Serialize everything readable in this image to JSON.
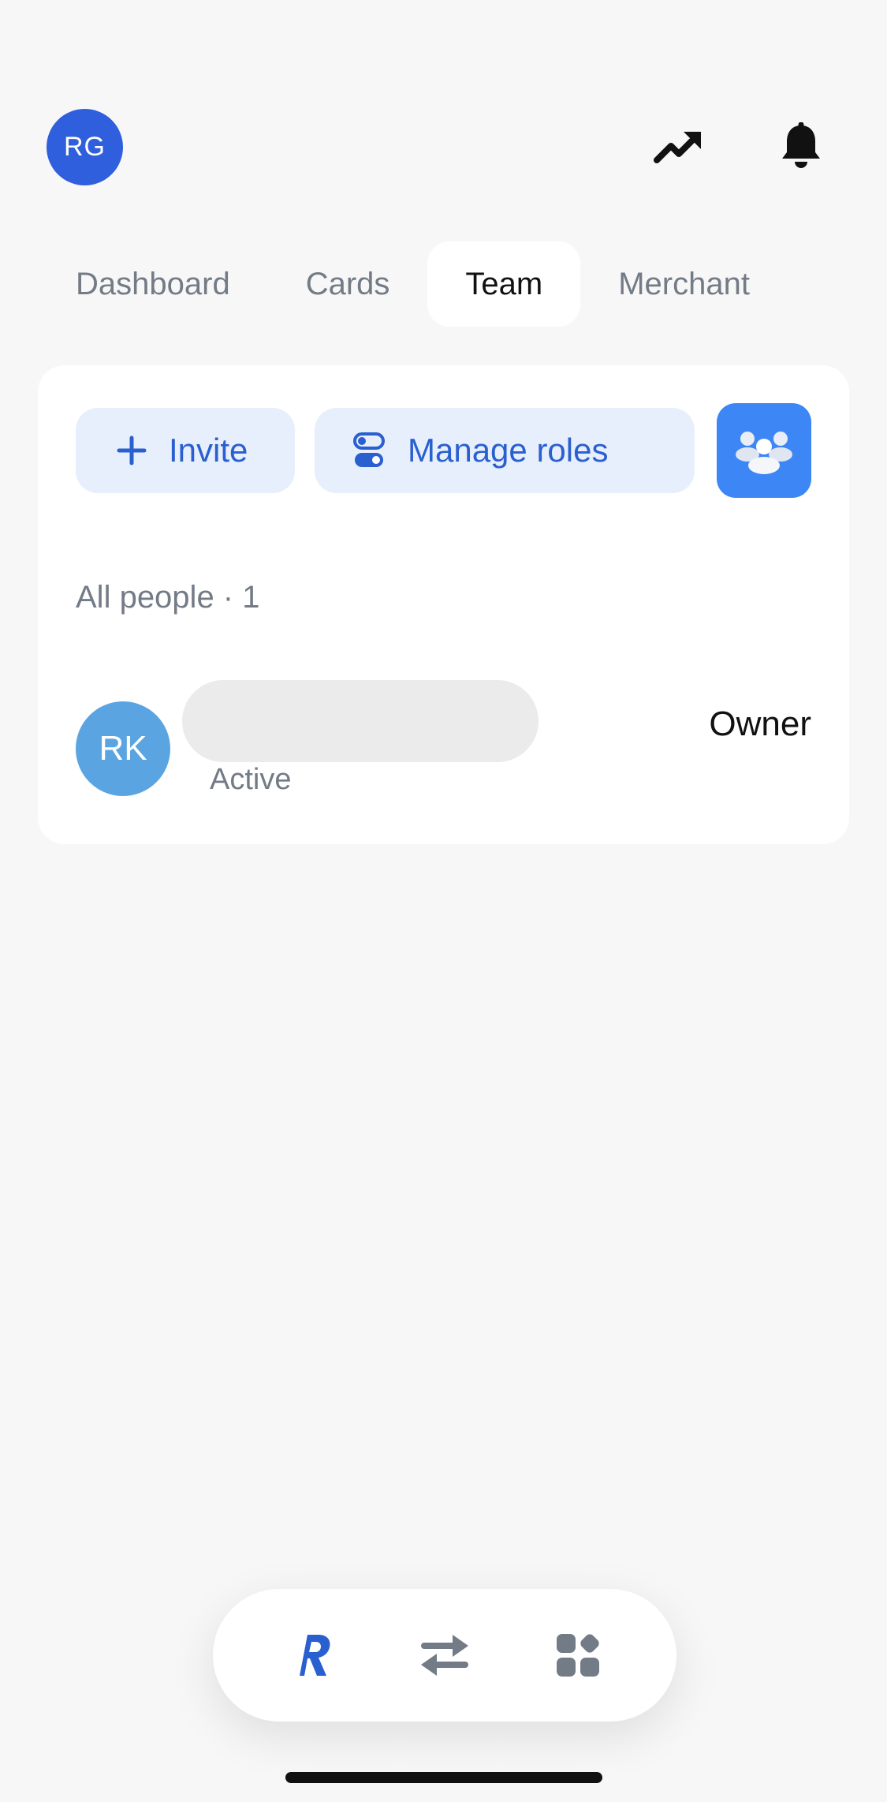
{
  "header": {
    "avatar_initials": "RG",
    "trend_icon": "trending-up-icon",
    "bell_icon": "bell-icon"
  },
  "tabs": [
    {
      "label": "Dashboard",
      "active": false
    },
    {
      "label": "Cards",
      "active": false
    },
    {
      "label": "Team",
      "active": true
    },
    {
      "label": "Merchant",
      "active": false
    }
  ],
  "actions": {
    "invite_label": "Invite",
    "manage_roles_label": "Manage roles"
  },
  "people": {
    "section_title": "All people · 1",
    "members": [
      {
        "initials": "RK",
        "status": "Active",
        "role": "Owner"
      }
    ]
  },
  "bottom_nav": {
    "items": [
      "home-logo-icon",
      "transfer-icon",
      "apps-grid-icon"
    ]
  },
  "colors": {
    "accent": "#2a5fd0",
    "pill_bg": "#e6effb",
    "avatar_primary": "#2f5fdd",
    "member_avatar": "#5aa5e1",
    "team_tile": "#3d86f5"
  }
}
